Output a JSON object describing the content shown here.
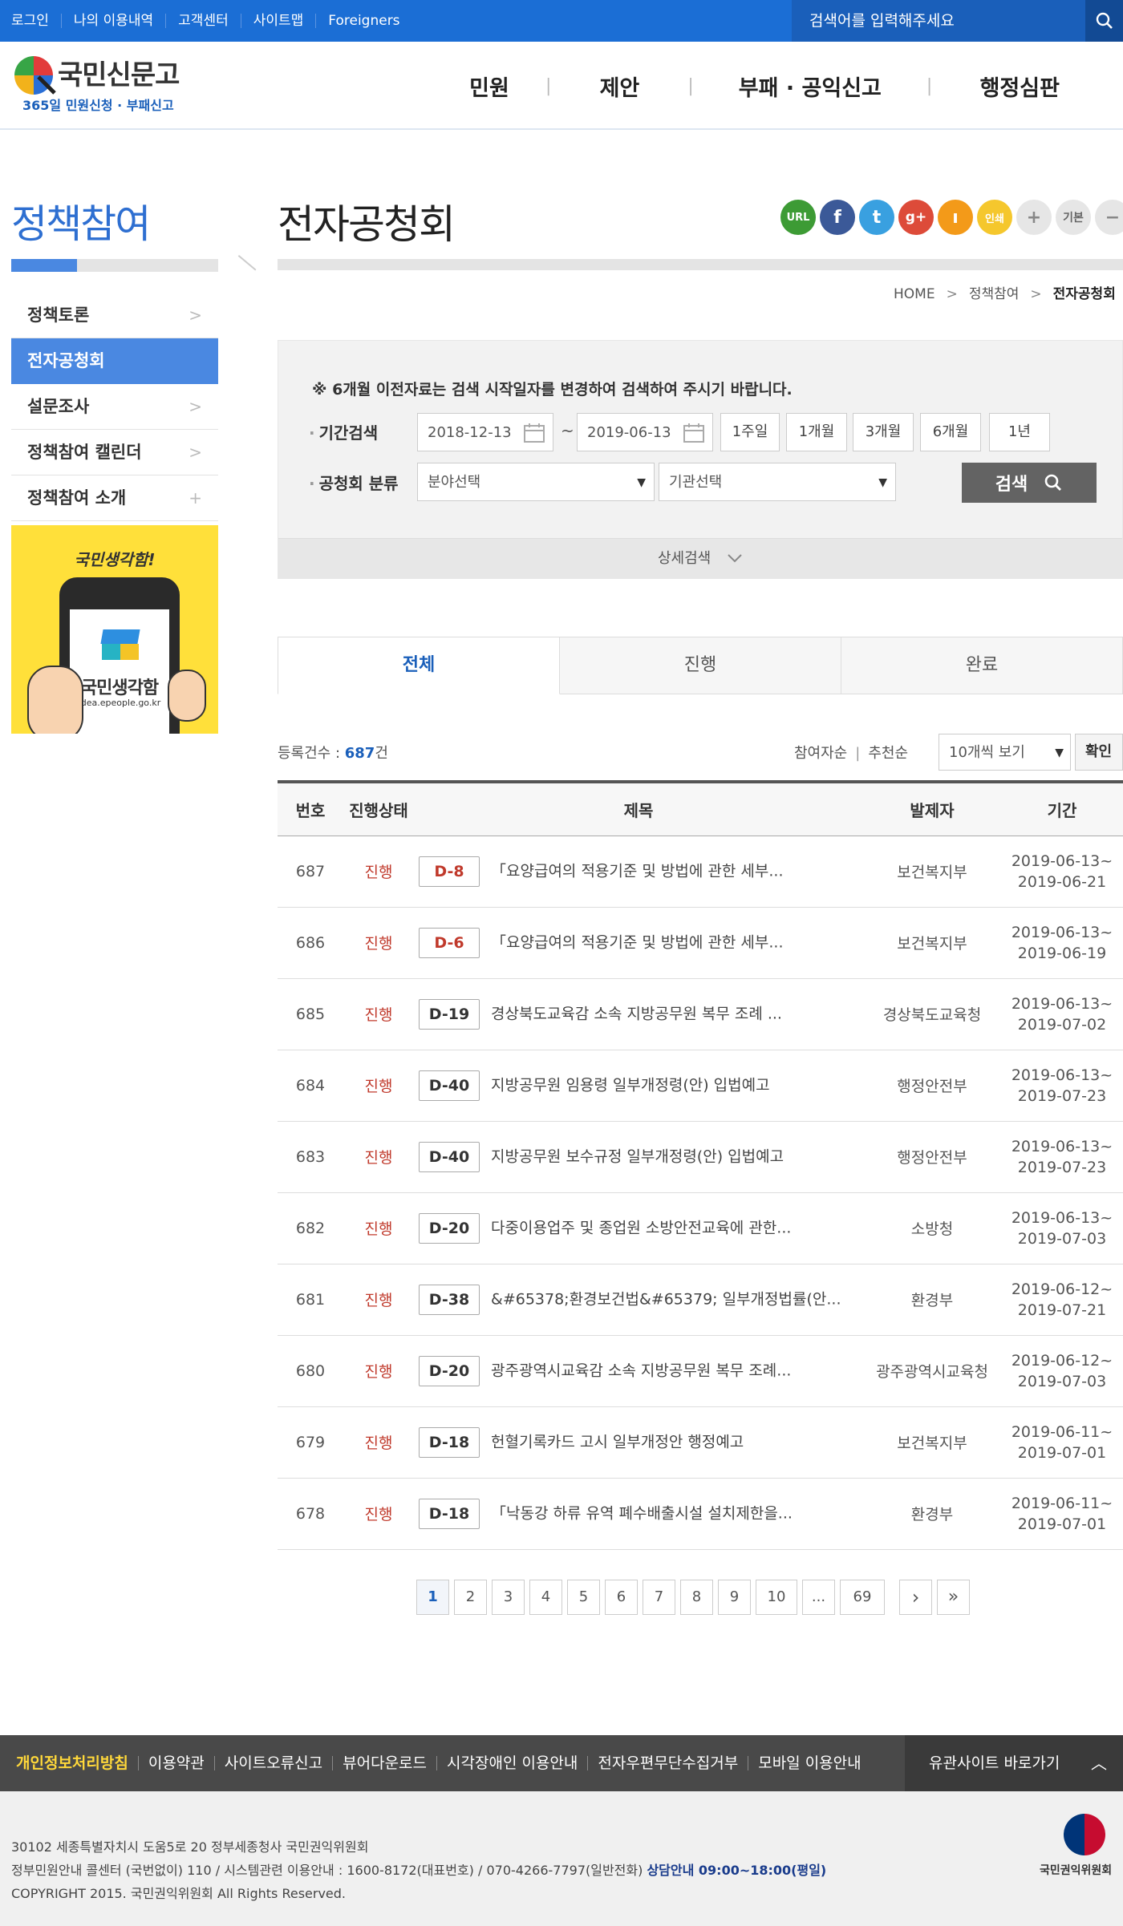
{
  "topbar": {
    "links": [
      "로그인",
      "나의 이용내역",
      "고객센터",
      "사이트맵",
      "Foreigners"
    ],
    "search_placeholder": "검색어를 입력해주세요"
  },
  "header": {
    "logo_title": "국민신문고",
    "logo_sub": "365일 민원신청 · 부패신고",
    "gnb": [
      "민원",
      "제안",
      "부패 · 공익신고",
      "행정심판"
    ]
  },
  "lnb": {
    "title": "정책참여",
    "items": [
      {
        "label": "정책토론",
        "arrow": ">"
      },
      {
        "label": "전자공청회",
        "arrow": ""
      },
      {
        "label": "설문조사",
        "arrow": ">"
      },
      {
        "label": "정책참여 캘린더",
        "arrow": ">"
      },
      {
        "label": "정책참여 소개",
        "arrow": "+"
      }
    ],
    "banner": {
      "title": "국민생각함!",
      "name": "국민생각함",
      "url": "idea.epeople.go.kr"
    }
  },
  "content": {
    "title": "전자공청회",
    "sns": [
      {
        "label": "URL",
        "color": "#3d9b35"
      },
      {
        "label": "f",
        "color": "#3b5998"
      },
      {
        "label": "t",
        "color": "#39a0e0"
      },
      {
        "label": "g+",
        "color": "#dd4b39"
      },
      {
        "label": "ı",
        "color": "#f39a19"
      },
      {
        "label": "인쇄",
        "color": "#f5c72d"
      },
      {
        "label": "+",
        "color": "#e6e6e6"
      },
      {
        "label": "기본",
        "color": "#e6e6e6"
      },
      {
        "label": "−",
        "color": "#e6e6e6"
      }
    ],
    "breadcrumb": [
      "HOME",
      "정책참여",
      "전자공청회"
    ]
  },
  "search": {
    "notice": "※ 6개월 이전자료는 검색 시작일자를 변경하여 검색하여 주시기 바랍니다.",
    "period_label": "기간검색",
    "date_from": "2018-12-13",
    "date_to": "2019-06-13",
    "tilde": "~",
    "period_buttons": [
      "1주일",
      "1개월",
      "3개월",
      "6개월",
      "1년"
    ],
    "category_label": "공청회 분류",
    "field_select": "분야선택",
    "agency_select": "기관선택",
    "search_button": "검색",
    "detail_search": "상세검색"
  },
  "tabs": [
    "전체",
    "진행",
    "완료"
  ],
  "list": {
    "count_label": "등록건수 : ",
    "count": "687",
    "count_unit": "건",
    "sort_options": [
      "참여자순",
      "추천순"
    ],
    "view_select": "10개씩 보기",
    "confirm": "확인",
    "columns": [
      "번호",
      "진행상태",
      "제목",
      "발제자",
      "기간"
    ],
    "rows": [
      {
        "no": "687",
        "status": "진행",
        "dday": "D-8",
        "urgent": true,
        "title": "「요양급여의 적용기준 및 방법에 관한 세부...",
        "author": "보건복지부",
        "from": "2019-06-13~",
        "to": "2019-06-21"
      },
      {
        "no": "686",
        "status": "진행",
        "dday": "D-6",
        "urgent": true,
        "title": "「요양급여의 적용기준 및 방법에 관한 세부...",
        "author": "보건복지부",
        "from": "2019-06-13~",
        "to": "2019-06-19"
      },
      {
        "no": "685",
        "status": "진행",
        "dday": "D-19",
        "urgent": false,
        "title": "경상북도교육감 소속 지방공무원 복무 조례 ...",
        "author": "경상북도교육청",
        "from": "2019-06-13~",
        "to": "2019-07-02"
      },
      {
        "no": "684",
        "status": "진행",
        "dday": "D-40",
        "urgent": false,
        "title": "지방공무원 임용령 일부개정령(안) 입법예고",
        "author": "행정안전부",
        "from": "2019-06-13~",
        "to": "2019-07-23"
      },
      {
        "no": "683",
        "status": "진행",
        "dday": "D-40",
        "urgent": false,
        "title": "지방공무원 보수규정 일부개정령(안) 입법예고",
        "author": "행정안전부",
        "from": "2019-06-13~",
        "to": "2019-07-23"
      },
      {
        "no": "682",
        "status": "진행",
        "dday": "D-20",
        "urgent": false,
        "title": "다중이용업주 및 종업원 소방안전교육에 관한...",
        "author": "소방청",
        "from": "2019-06-13~",
        "to": "2019-07-03"
      },
      {
        "no": "681",
        "status": "진행",
        "dday": "D-38",
        "urgent": false,
        "title": "&#65378;환경보건법&#65379; 일부개정법률(안...",
        "author": "환경부",
        "from": "2019-06-12~",
        "to": "2019-07-21"
      },
      {
        "no": "680",
        "status": "진행",
        "dday": "D-20",
        "urgent": false,
        "title": "광주광역시교육감 소속 지방공무원 복무 조례...",
        "author": "광주광역시교육청",
        "from": "2019-06-12~",
        "to": "2019-07-03"
      },
      {
        "no": "679",
        "status": "진행",
        "dday": "D-18",
        "urgent": false,
        "title": "헌혈기록카드 고시 일부개정안 행정예고",
        "author": "보건복지부",
        "from": "2019-06-11~",
        "to": "2019-07-01"
      },
      {
        "no": "678",
        "status": "진행",
        "dday": "D-18",
        "urgent": false,
        "title": "「낙동강 하류 유역 폐수배출시설 설치제한을...",
        "author": "환경부",
        "from": "2019-06-11~",
        "to": "2019-07-01"
      }
    ]
  },
  "pagination": {
    "pages": [
      "1",
      "2",
      "3",
      "4",
      "5",
      "6",
      "7",
      "8",
      "9",
      "10"
    ],
    "current": "1",
    "ellipsis": "...",
    "last": "69",
    "next": "›",
    "end": "»"
  },
  "footer": {
    "links": [
      "개인정보처리방침",
      "이용약관",
      "사이트오류신고",
      "뷰어다운로드",
      "시각장애인 이용안내",
      "전자우편무단수집거부",
      "모바일 이용안내"
    ],
    "family_site": "유관사이트 바로가기",
    "address": "30102 세종특별자치시 도움5로 20 정부세종청사 국민권익위원회",
    "contact": "정부민원안내 콜센터 (국번없이) 110 / 시스템관련 이용안내 : 1600-8172(대표번호) / 070-4266-7797(일반전화)",
    "hours": "상담안내 09:00~18:00(평일)",
    "copyright": "COPYRIGHT 2015. 국민권익위원회 All Rights Reserved.",
    "org": "국민권익위원회"
  }
}
